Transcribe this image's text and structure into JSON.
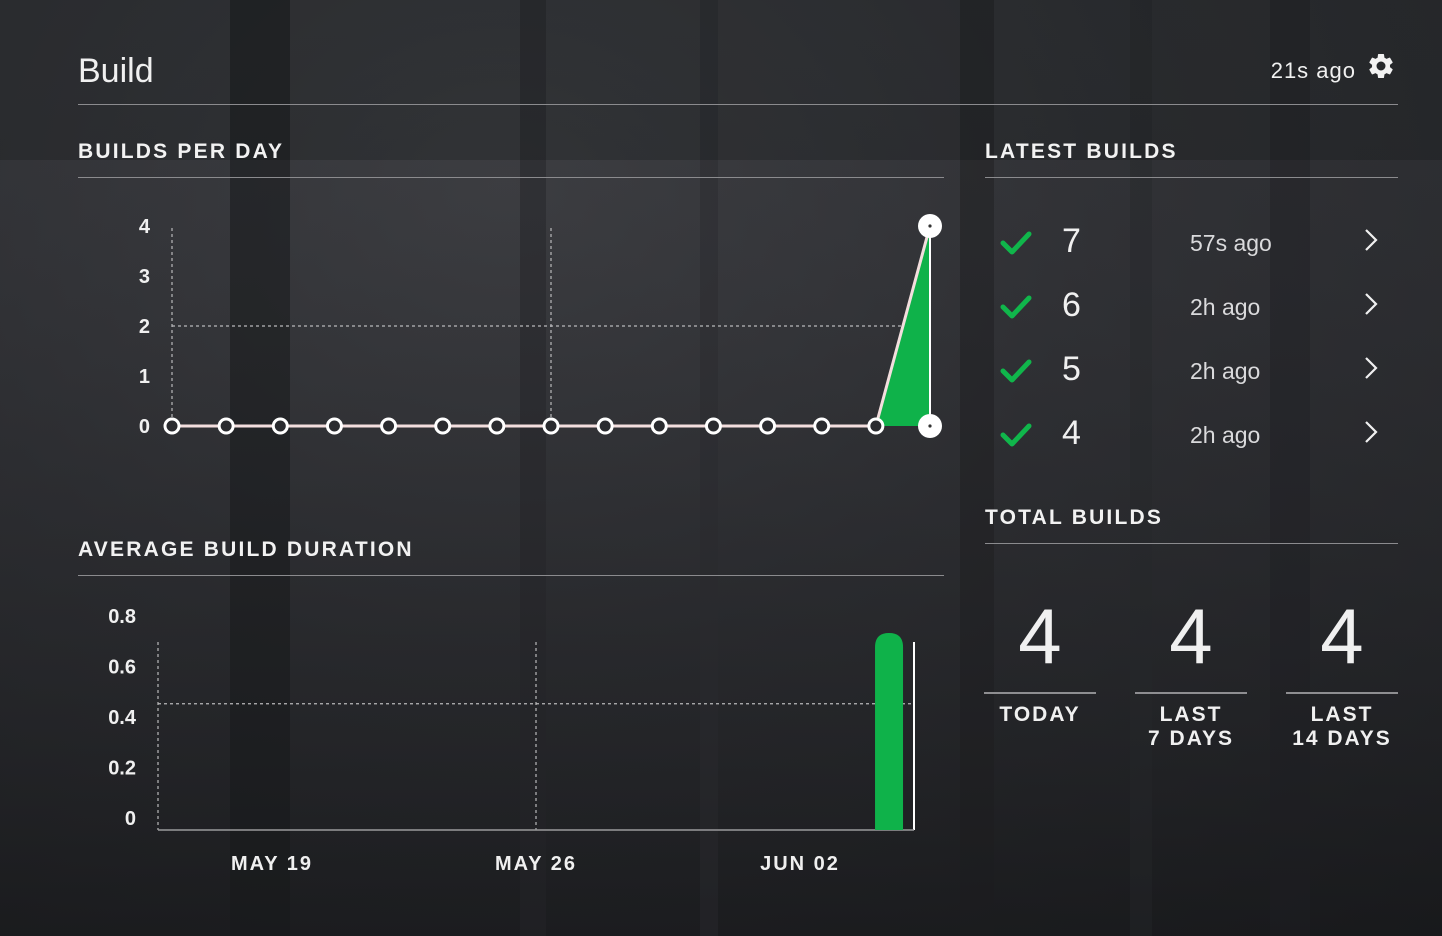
{
  "header": {
    "title": "Build",
    "updated": "21s ago",
    "settings_icon": "gear-icon"
  },
  "builds_per_day": {
    "title": "BUILDS PER DAY",
    "chart_data": {
      "type": "area",
      "title": "BUILDS PER DAY",
      "y_ticks": [
        "0",
        "1",
        "2",
        "3",
        "4"
      ],
      "ylim": [
        0,
        4
      ],
      "x": [
        1,
        2,
        3,
        4,
        5,
        6,
        7,
        8,
        9,
        10,
        11,
        12,
        13,
        14,
        15
      ],
      "values": [
        0,
        0,
        0,
        0,
        0,
        0,
        0,
        0,
        0,
        0,
        0,
        0,
        0,
        0,
        4
      ],
      "grid": true,
      "colors": {
        "fill": "#0fb24a",
        "line": "#f3dede",
        "point": "#ffffff"
      }
    }
  },
  "average_duration": {
    "title": "AVERAGE BUILD DURATION",
    "chart_data": {
      "type": "bar",
      "title": "AVERAGE BUILD DURATION",
      "y_ticks": [
        "0",
        "0.2",
        "0.4",
        "0.6",
        "0.8"
      ],
      "ylim": [
        0,
        0.8
      ],
      "x_labels": [
        "MAY 19",
        "MAY 26",
        "JUN 02"
      ],
      "x": [
        "May 12",
        "May 13",
        "May 14",
        "May 15",
        "May 16",
        "May 17",
        "May 18",
        "May 19",
        "May 20",
        "May 21",
        "May 22",
        "May 23",
        "May 24",
        "May 25",
        "May 26",
        "May 27",
        "May 28",
        "May 29",
        "May 30",
        "May 31",
        "Jun 01",
        "Jun 02",
        "Jun 03",
        "Jun 04",
        "Jun 05",
        "Jun 06",
        "Jun 07",
        "Jun 08",
        "Jun 09"
      ],
      "values": [
        0,
        0,
        0,
        0,
        0,
        0,
        0,
        0,
        0,
        0,
        0,
        0,
        0,
        0,
        0,
        0,
        0,
        0,
        0,
        0,
        0,
        0,
        0,
        0,
        0,
        0,
        0,
        0,
        0.78
      ],
      "grid": true,
      "colors": {
        "bar": "#0fb24a"
      }
    }
  },
  "latest_builds": {
    "title": "LATEST BUILDS",
    "items": [
      {
        "number": "7",
        "ago": "57s ago",
        "status": "success",
        "icon": "check-icon"
      },
      {
        "number": "6",
        "ago": "2h ago",
        "status": "success",
        "icon": "check-icon"
      },
      {
        "number": "5",
        "ago": "2h ago",
        "status": "success",
        "icon": "check-icon"
      },
      {
        "number": "4",
        "ago": "2h ago",
        "status": "success",
        "icon": "check-icon"
      }
    ]
  },
  "total_builds": {
    "title": "TOTAL BUILDS",
    "items": [
      {
        "value": "4",
        "label_line1": "TODAY",
        "label_line2": ""
      },
      {
        "value": "4",
        "label_line1": "LAST",
        "label_line2": "7 DAYS"
      },
      {
        "value": "4",
        "label_line1": "LAST",
        "label_line2": "14 DAYS"
      }
    ]
  },
  "colors": {
    "accent": "#0fb24a",
    "text": "#f0f0f0",
    "rule": "#8b8b8e"
  }
}
